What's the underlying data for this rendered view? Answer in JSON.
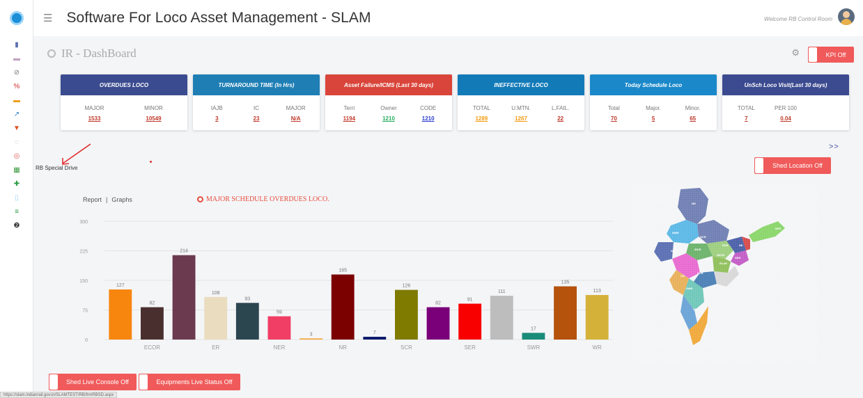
{
  "header": {
    "app_title": "Software For Loco Asset Management - SLAM",
    "welcome": "Welcome RB Control Room"
  },
  "page": {
    "title": "IR - DashBoard",
    "kpi_toggle": "KPI Off"
  },
  "cards": [
    {
      "title": "OVERDUES LOCO",
      "color": "#3b4b8f",
      "metrics": [
        {
          "k": "MAJOR",
          "v": "1533",
          "c": "#c0392b"
        },
        {
          "k": "MINOR",
          "v": "10549",
          "c": "#c0392b"
        }
      ]
    },
    {
      "title": "TURNAROUND TIME (In Hrs)",
      "color": "#1f7fb5",
      "metrics": [
        {
          "k": "IAJB",
          "v": "3",
          "c": "#c0392b"
        },
        {
          "k": "IC",
          "v": "23",
          "c": "#c0392b"
        },
        {
          "k": "MAJOR",
          "v": "N/A",
          "c": "#c0392b"
        }
      ]
    },
    {
      "title": "Asset Failure/ICMS (Last 30 days)",
      "color": "#d9453a",
      "metrics": [
        {
          "k": "Terri",
          "v": "1194",
          "c": "#c0392b"
        },
        {
          "k": "Owner",
          "v": "1210",
          "c": "#27ae60"
        },
        {
          "k": "CODE",
          "v": "1210",
          "c": "#2b3bd1"
        }
      ]
    },
    {
      "title": "INEFFECTIVE LOCO",
      "color": "#137ab8",
      "metrics": [
        {
          "k": "TOTAL",
          "v": "1289",
          "c": "#f39c12"
        },
        {
          "k": "U.MTN.",
          "v": "1267",
          "c": "#f39c12"
        },
        {
          "k": "L.FAIL.",
          "v": "22",
          "c": "#c0392b"
        }
      ]
    },
    {
      "title": "Today Schedule Loco",
      "color": "#1b88c9",
      "metrics": [
        {
          "k": "Total",
          "v": "70",
          "c": "#c0392b"
        },
        {
          "k": "Major.",
          "v": "5",
          "c": "#c0392b"
        },
        {
          "k": "Minor.",
          "v": "65",
          "c": "#c0392b"
        }
      ]
    },
    {
      "title": "UnSch Loco Visit(Last 30 days)",
      "color": "#3c4a90",
      "metrics": [
        {
          "k": "TOTAL",
          "v": "7",
          "c": "#c0392b"
        },
        {
          "k": "PER 100",
          "v": "0.04",
          "c": "#c0392b"
        }
      ]
    }
  ],
  "scroll_arrows": ">>",
  "rb_special_drive": "RB Special Drive",
  "shed_location_toggle": "Shed Location Off",
  "chart_panel": {
    "tab_report": "Report",
    "tab_sep": "|",
    "tab_graphs": "Graphs",
    "title": "MAJOR SCHEDULE OVERDUES LOCO."
  },
  "chart_data": {
    "type": "bar",
    "title": "MAJOR SCHEDULE OVERDUES LOCO.",
    "ylim": [
      0,
      300
    ],
    "yticks": [
      0,
      75,
      150,
      225,
      300
    ],
    "x_tick_labels": [
      "ECOR",
      "ER",
      "NER",
      "NR",
      "SCR",
      "SER",
      "SWR",
      "WR"
    ],
    "values": [
      127,
      82,
      214,
      108,
      93,
      59,
      3,
      165,
      7,
      126,
      82,
      91,
      111,
      17,
      135,
      113
    ],
    "colors": [
      "#f7860f",
      "#4a2f2f",
      "#6b3a4f",
      "#eadcbf",
      "#2c4650",
      "#f03e64",
      "#f7a63a",
      "#7b0000",
      "#0b1a6b",
      "#7e7b00",
      "#7a007a",
      "#f80000",
      "#bdbdbd",
      "#1a8c7a",
      "#b5520c",
      "#d4b23a"
    ],
    "grid": true
  },
  "map": {
    "zones": [
      "NR",
      "NWR",
      "NCR",
      "NER",
      "NFR",
      "WR",
      "WCR",
      "ECR",
      "ER",
      "SECR",
      "ECoR",
      "CR",
      "SCR",
      "SWR",
      "SR",
      "NE",
      "SER"
    ]
  },
  "bottom": {
    "shed_live_console": "Shed Live Console Off",
    "equipments_live": "Equipments Live Status Off"
  },
  "status_url": "https://slam.indianrail.gov.in/SLAMTEST/RB/frmRBSD.aspx"
}
